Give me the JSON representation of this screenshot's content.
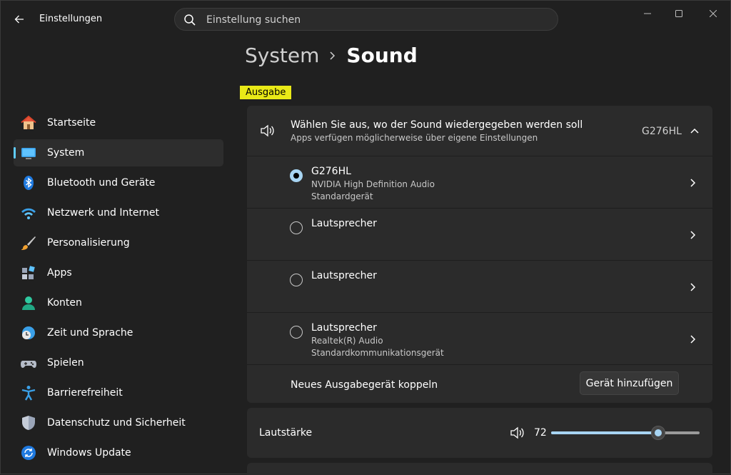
{
  "window": {
    "title": "Einstellungen",
    "search_placeholder": "Einstellung suchen"
  },
  "breadcrumb": {
    "parent": "System",
    "current": "Sound"
  },
  "section_label": "Ausgabe",
  "sidebar": {
    "items": [
      {
        "label": "Startseite",
        "icon": "home-icon"
      },
      {
        "label": "System",
        "icon": "system-icon",
        "active": true
      },
      {
        "label": "Bluetooth und Geräte",
        "icon": "bluetooth-icon"
      },
      {
        "label": "Netzwerk und Internet",
        "icon": "wifi-icon"
      },
      {
        "label": "Personalisierung",
        "icon": "brush-icon"
      },
      {
        "label": "Apps",
        "icon": "apps-icon"
      },
      {
        "label": "Konten",
        "icon": "account-icon"
      },
      {
        "label": "Zeit und Sprache",
        "icon": "clock-globe-icon"
      },
      {
        "label": "Spielen",
        "icon": "gamepad-icon"
      },
      {
        "label": "Barrierefreiheit",
        "icon": "accessibility-icon"
      },
      {
        "label": "Datenschutz und Sicherheit",
        "icon": "shield-icon"
      },
      {
        "label": "Windows Update",
        "icon": "update-icon"
      }
    ]
  },
  "output": {
    "title": "Wählen Sie aus, wo der Sound wiedergegeben werden soll",
    "subtitle": "Apps verfügen möglicherweise über eigene Einstellungen",
    "selected_device": "G276HL",
    "devices": [
      {
        "name": "G276HL",
        "line1": "NVIDIA High Definition Audio",
        "line2": "Standardgerät",
        "selected": true
      },
      {
        "name": "Lautsprecher",
        "line1": "",
        "line2": "",
        "selected": false
      },
      {
        "name": "Lautsprecher",
        "line1": "",
        "line2": "",
        "selected": false
      },
      {
        "name": "Lautsprecher",
        "line1": "Realtek(R) Audio",
        "line2": "Standardkommunikationsgerät",
        "selected": false
      }
    ],
    "pair_label": "Neues Ausgabegerät koppeln",
    "pair_button": "Gerät hinzufügen"
  },
  "volume": {
    "label": "Lautstärke",
    "value": "72",
    "level": 0.72
  },
  "colors": {
    "accent": "#60cdff",
    "radio_accent": "#a7d4f2",
    "highlight": "#e9e917"
  }
}
